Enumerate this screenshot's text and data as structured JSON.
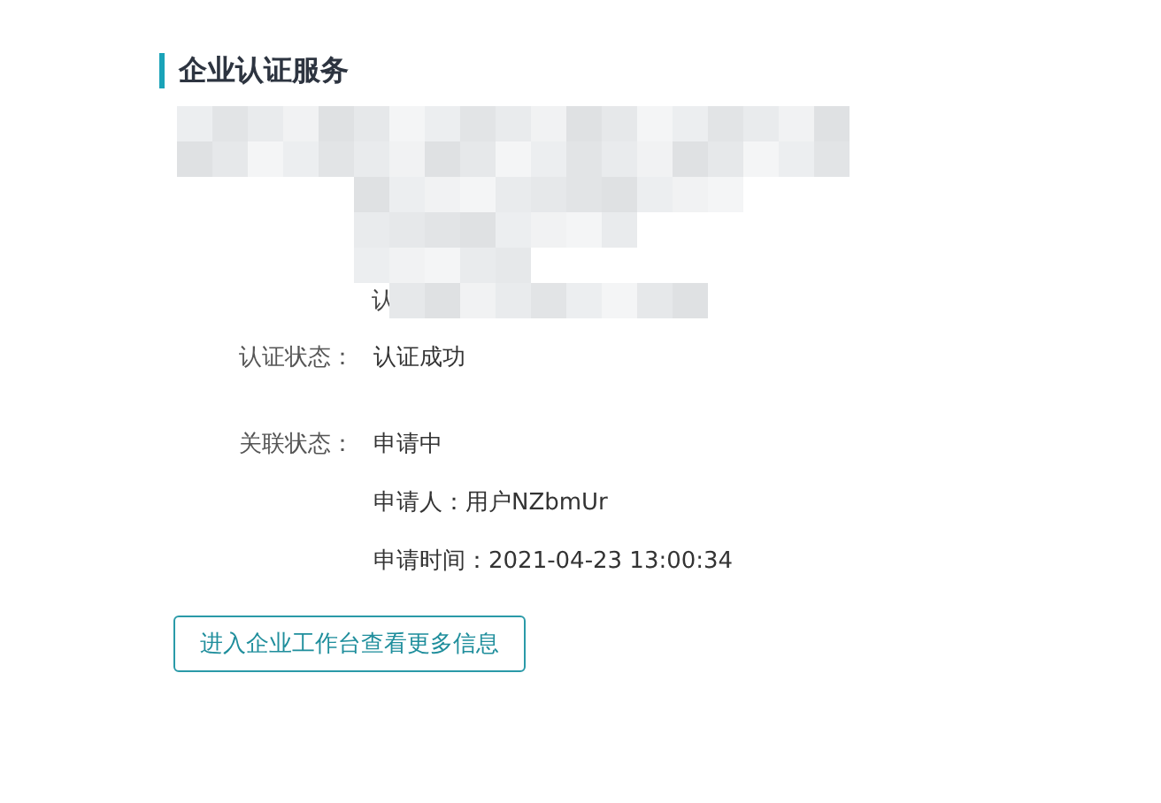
{
  "section_title": "企业认证服务",
  "partial_label": "认",
  "verification": {
    "label": "认证状态：",
    "value": "认证成功"
  },
  "association": {
    "label": "关联状态：",
    "value": "申请中",
    "details": [
      "申请人：用户NZbmUr",
      "申请时间：2021-04-23 13:00:34"
    ]
  },
  "button": "进入企业工作台查看更多信息"
}
